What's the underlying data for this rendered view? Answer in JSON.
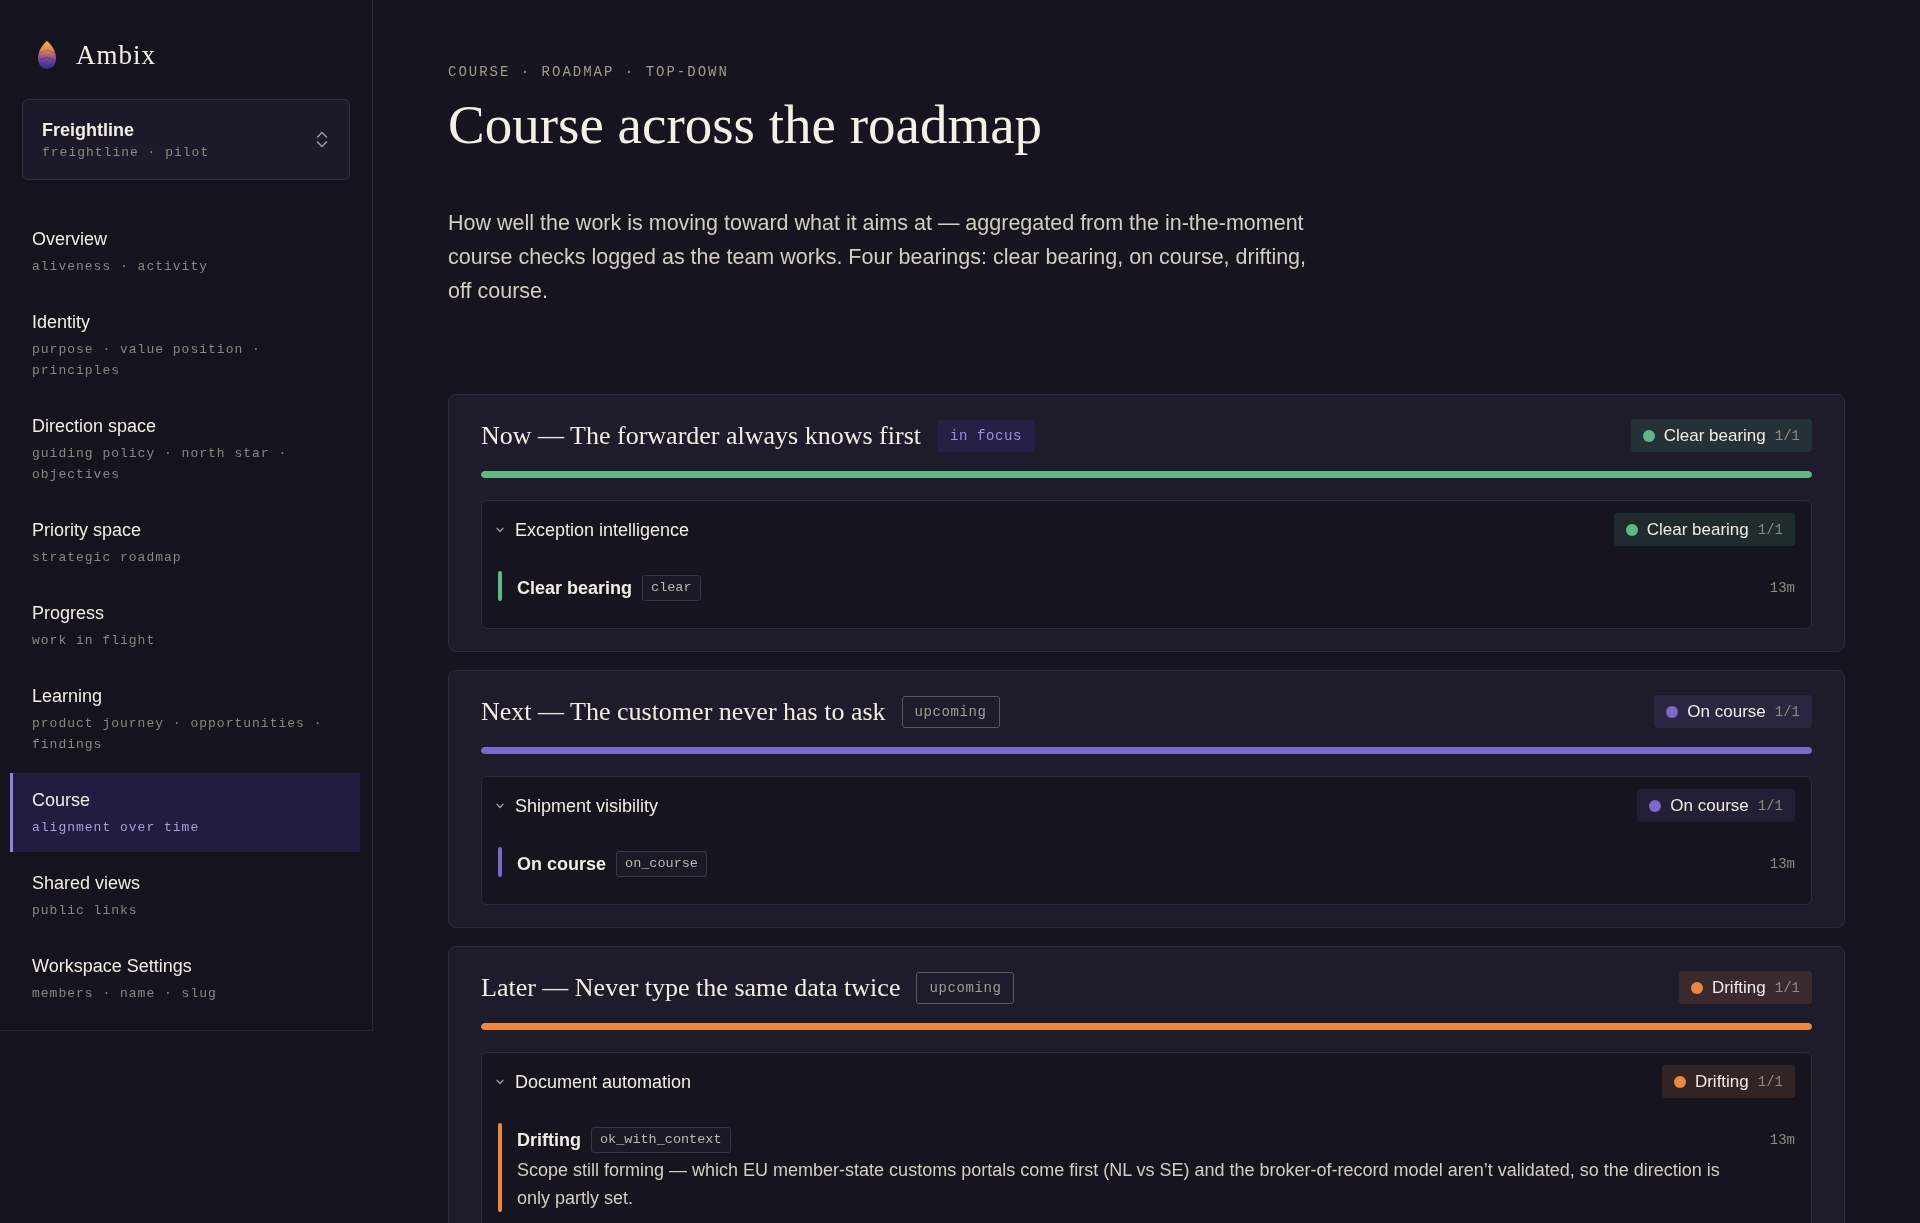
{
  "sidebar": {
    "brand": "Ambix",
    "workspace": {
      "name": "Freightline",
      "detail": "freightline · pilot"
    },
    "items": [
      {
        "label": "Overview",
        "detail": "aliveness · activity",
        "selected": false
      },
      {
        "label": "Identity",
        "detail": "purpose · value position · principles",
        "selected": false
      },
      {
        "label": "Direction space",
        "detail": "guiding policy · north star · objectives",
        "selected": false
      },
      {
        "label": "Priority space",
        "detail": "strategic roadmap",
        "selected": false
      },
      {
        "label": "Progress",
        "detail": "work in flight",
        "selected": false
      },
      {
        "label": "Learning",
        "detail": "product journey · opportunities · findings",
        "selected": false
      },
      {
        "label": "Course",
        "detail": "alignment over time",
        "selected": true
      },
      {
        "label": "Shared views",
        "detail": "public links",
        "selected": false
      },
      {
        "label": "Workspace Settings",
        "detail": "members · name · slug",
        "selected": false
      }
    ]
  },
  "header": {
    "breadcrumb": "COURSE · ROADMAP · TOP-DOWN",
    "title": "Course across the roadmap",
    "description": "How well the work is moving toward what it aims at — aggregated from the in-the-moment course checks logged as the team works. Four bearings: clear bearing, on course, drifting, off course."
  },
  "horizons": [
    {
      "title": "Now — The forwarder always knows first",
      "tag": {
        "text": "in focus",
        "kind": "focus"
      },
      "status": {
        "label": "Clear bearing",
        "count": "1/1",
        "color": "#5fb886"
      },
      "level": 1,
      "initiatives": [
        {
          "title": "Exception intelligence",
          "expanded": true,
          "status": {
            "label": "Clear bearing",
            "count": "1/1",
            "color": "#5fb886"
          },
          "checks": [
            {
              "label": "Clear bearing",
              "code": "clear",
              "time": "13m",
              "color": "#5fb886"
            }
          ]
        }
      ]
    },
    {
      "title": "Next — The customer never has to ask",
      "tag": {
        "text": "upcoming",
        "kind": "upcoming"
      },
      "status": {
        "label": "On course",
        "count": "1/1",
        "color": "#7b68c9"
      },
      "level": 1,
      "initiatives": [
        {
          "title": "Shipment visibility",
          "expanded": true,
          "status": {
            "label": "On course",
            "count": "1/1",
            "color": "#7b68c9"
          },
          "checks": [
            {
              "label": "On course",
              "code": "on_course",
              "time": "13m",
              "color": "#7b68c9"
            }
          ]
        }
      ]
    },
    {
      "title": "Later — Never type the same data twice",
      "tag": {
        "text": "upcoming",
        "kind": "upcoming"
      },
      "status": {
        "label": "Drifting",
        "count": "1/1",
        "color": "#e8893f"
      },
      "level": 1,
      "initiatives": [
        {
          "title": "Document automation",
          "expanded": true,
          "status": {
            "label": "Drifting",
            "count": "1/1",
            "color": "#e8893f"
          },
          "checks": [
            {
              "label": "Drifting",
              "code": "ok_with_context",
              "time": "13m",
              "color": "#e8893f",
              "note": "Scope still forming — which EU member-state customs portals come first (NL vs SE) and the broker-of-record model aren’t validated, so the direction is only partly set."
            }
          ]
        }
      ]
    }
  ]
}
